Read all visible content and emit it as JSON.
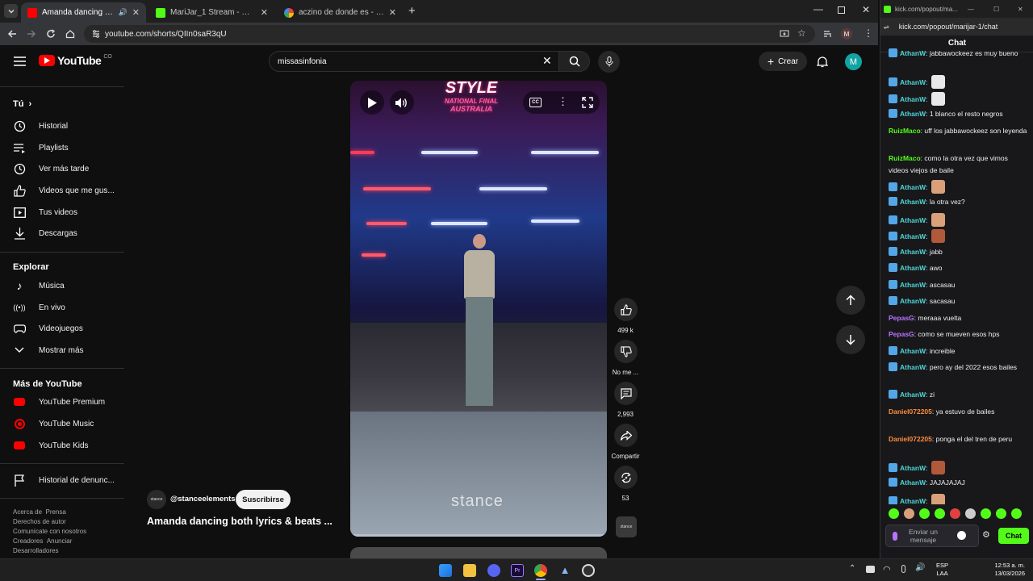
{
  "browser": {
    "tabs": [
      {
        "title": "Amanda dancing both lyrics & beats",
        "active": true
      },
      {
        "title": "MariJar_1 Stream - Watch Live on Kick",
        "active": false
      },
      {
        "title": "aczino de donde es - Buscar con Google",
        "active": false
      }
    ],
    "url": "youtube.com/shorts/QIIn0saR3qU",
    "profile_initial": "M"
  },
  "youtube": {
    "logo_text": "YouTube",
    "country": "CO",
    "search_value": "missasinfonia",
    "create_label": "Crear",
    "avatar_initial": "M",
    "sidebar": {
      "you_label": "Tú",
      "you_items": [
        "Historial",
        "Playlists",
        "Ver más tarde",
        "Videos que me gus...",
        "Tus videos",
        "Descargas"
      ],
      "explore_label": "Explorar",
      "explore_items": [
        "Música",
        "En vivo",
        "Videojuegos",
        "Mostrar más"
      ],
      "more_label": "Más de YouTube",
      "more_items": [
        "YouTube Premium",
        "YouTube Music",
        "YouTube Kids"
      ],
      "report_history": "Historial de denunc...",
      "footer_lines": [
        [
          "Acerca de",
          "Prensa"
        ],
        [
          "Derechos de autor"
        ],
        [
          "Comunícate con nosotros"
        ],
        [
          "Creadores",
          "Anunciar"
        ],
        [
          "Desarrolladores"
        ]
      ]
    },
    "video": {
      "overlay_line1": "STYLE",
      "overlay_line2": "NATIONAL FINAL",
      "overlay_line3": "AUSTRALIA",
      "watermark": "stance",
      "channel": "@stanceelements",
      "subscribe_label": "Suscribirse",
      "title": "Amanda dancing both lyrics & beats ..."
    },
    "actions": {
      "likes": "499 k",
      "dislike_label": "No me ...",
      "comments": "2,993",
      "share_label": "Compartir",
      "remix_count": "53"
    }
  },
  "chat": {
    "window_url": "kick.com/popout/ma...",
    "url": "kick.com/popout/marijar-1/chat",
    "title": "Chat",
    "messages": [
      {
        "user": "AthanW",
        "text": "jabbawockeez es muy bueno",
        "color": "blue",
        "badge": true
      },
      {
        "user": "AthanW",
        "text": "",
        "color": "blue",
        "badge": true,
        "emote": "#e8e8e8"
      },
      {
        "user": "AthanW",
        "text": "",
        "color": "blue",
        "badge": true,
        "emote": "#e8e8e8"
      },
      {
        "user": "AthanW",
        "text": "1 blanco el resto negros",
        "color": "blue",
        "badge": true
      },
      {
        "user": "RuizMaco",
        "text": "uff los jabbawockeez son leyenda",
        "color": "green",
        "badge": false
      },
      {
        "user": "RuizMaco",
        "text": "como la otra vez que vimos videos viejos de baile",
        "color": "green",
        "badge": false
      },
      {
        "user": "AthanW",
        "text": "",
        "color": "blue",
        "badge": true,
        "emote": "#d9a07a"
      },
      {
        "user": "AthanW",
        "text": "la otra vez?",
        "color": "blue",
        "badge": true
      },
      {
        "user": "AthanW",
        "text": "",
        "color": "blue",
        "badge": true,
        "emote": "#d9a07a"
      },
      {
        "user": "AthanW",
        "text": "",
        "color": "blue",
        "badge": true,
        "emote": "#b05a3a"
      },
      {
        "user": "AthanW",
        "text": "jabb",
        "color": "blue",
        "badge": true
      },
      {
        "user": "AthanW",
        "text": "awo",
        "color": "blue",
        "badge": true
      },
      {
        "user": "AthanW",
        "text": "ascasau",
        "color": "blue",
        "badge": true
      },
      {
        "user": "AthanW",
        "text": "sacasau",
        "color": "blue",
        "badge": true
      },
      {
        "user": "PepasG",
        "text": "meraaa vuelta",
        "color": "purple",
        "badge": false
      },
      {
        "user": "PepasG",
        "text": "como se mueven esos hps",
        "color": "purple",
        "badge": false
      },
      {
        "user": "AthanW",
        "text": "increible",
        "color": "blue",
        "badge": true
      },
      {
        "user": "AthanW",
        "text": "pero ay del 2022 esos bailes",
        "color": "blue",
        "badge": true
      },
      {
        "user": "AthanW",
        "text": "zi",
        "color": "blue",
        "badge": true
      },
      {
        "user": "Daniel072205",
        "text": "ya estuvo de bailes",
        "color": "orange",
        "badge": false
      },
      {
        "user": "Daniel072205",
        "text": "ponga el del tren de peru",
        "color": "orange",
        "badge": false
      },
      {
        "user": "AthanW",
        "text": "",
        "color": "blue",
        "badge": true,
        "emote": "#b05a3a"
      },
      {
        "user": "AthanW",
        "text": "JAJAJAJAJ",
        "color": "blue",
        "badge": true
      },
      {
        "user": "AthanW",
        "text": "",
        "color": "blue",
        "badge": true,
        "emote": "#d9a07a"
      }
    ],
    "input_placeholder": "Enviar un mensaje",
    "send_label": "Chat"
  },
  "taskbar": {
    "lang_line1": "ESP",
    "lang_line2": "LAA",
    "time": "12:53 a. m.",
    "date": "13/03/2026"
  }
}
